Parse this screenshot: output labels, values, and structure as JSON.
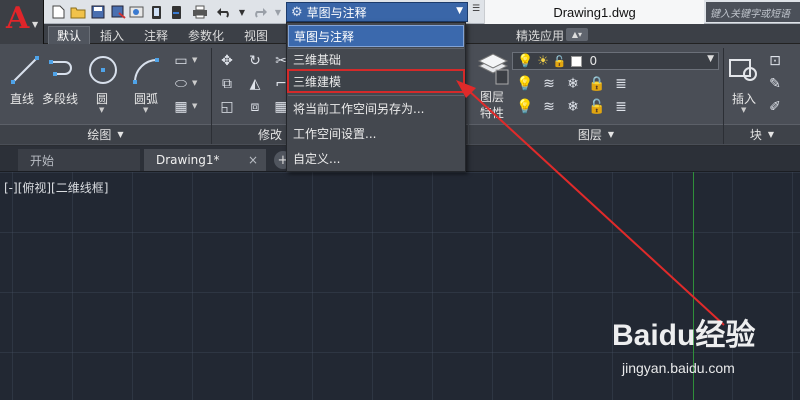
{
  "app": {
    "logo_letter": "A",
    "document_title": "Drawing1.dwg",
    "search_placeholder": "键入关键字或短语"
  },
  "workspace_combo": {
    "value": "草图与注释"
  },
  "ribbon_tabs": [
    {
      "label": "默认",
      "active": true
    },
    {
      "label": "插入"
    },
    {
      "label": "注释"
    },
    {
      "label": "参数化"
    },
    {
      "label": "视图"
    },
    {
      "label": "精选应用"
    }
  ],
  "draw_panel": {
    "title": "绘图",
    "tools": [
      {
        "label": "直线",
        "icon": "line-icon"
      },
      {
        "label": "多段线",
        "icon": "polyline-icon"
      },
      {
        "label": "圆",
        "icon": "circle-icon"
      },
      {
        "label": "圆弧",
        "icon": "arc-icon"
      }
    ]
  },
  "modify_panel": {
    "title": "修改"
  },
  "layer_panel": {
    "title": "图层",
    "big_tool_label": "图层",
    "big_tool_label2": "特性",
    "layer_combo_value": "0"
  },
  "block_panel": {
    "title": "块",
    "insert_label": "插入"
  },
  "workspace_menu": {
    "items": [
      {
        "label": "草图与注释",
        "selected": true
      },
      {
        "label": "三维基础"
      },
      {
        "label": "三维建模",
        "highlighted": true
      },
      {
        "label": "将当前工作空间另存为..."
      },
      {
        "label": "工作空间设置..."
      },
      {
        "label": "自定义..."
      }
    ]
  },
  "file_tabs": [
    {
      "label": "开始"
    },
    {
      "label": "Drawing1*",
      "active": true,
      "close": "×"
    }
  ],
  "viewport": {
    "label": "[-][俯视][二维线框]"
  },
  "watermark": {
    "brand": "Baidu经验",
    "url": "jingyan.baidu.com"
  },
  "colors": {
    "accent_blue": "#3b69ad",
    "highlight_red": "#d42a2a",
    "canvas_bg": "#222833",
    "ribbon_bg": "#4a4e56"
  }
}
